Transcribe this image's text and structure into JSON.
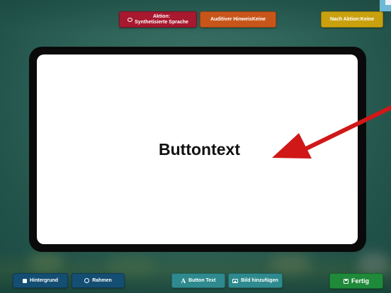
{
  "top_bar": {
    "action_label_line1": "Aktion:",
    "action_label_line2": "Synthetisierte Sprache",
    "action_icon": "speech-bubble-icon",
    "audio_hint_label": "Auditiver HinweisKeine",
    "next_action_label": "Nach Aktion:Keine"
  },
  "card": {
    "text": "Buttontext"
  },
  "annotation": {
    "arrow_color": "#d01818"
  },
  "bottom_bar": {
    "background_label": "Hintergrund",
    "background_icon": "square-icon",
    "frame_label": "Rahmen",
    "frame_icon": "circle-icon",
    "button_text_label": "Button Text",
    "button_text_icon": "letter-a-icon",
    "add_image_label": "Bild hinzufügen",
    "add_image_icon": "image-icon",
    "done_label": "Fertig",
    "done_icon": "save-icon"
  },
  "colors": {
    "action": "#a8182e",
    "audio_hint": "#c8561a",
    "next_action": "#c9a10f",
    "dark_blue": "#144e73",
    "teal": "#2e8a8e",
    "done": "#1f8a3a"
  }
}
